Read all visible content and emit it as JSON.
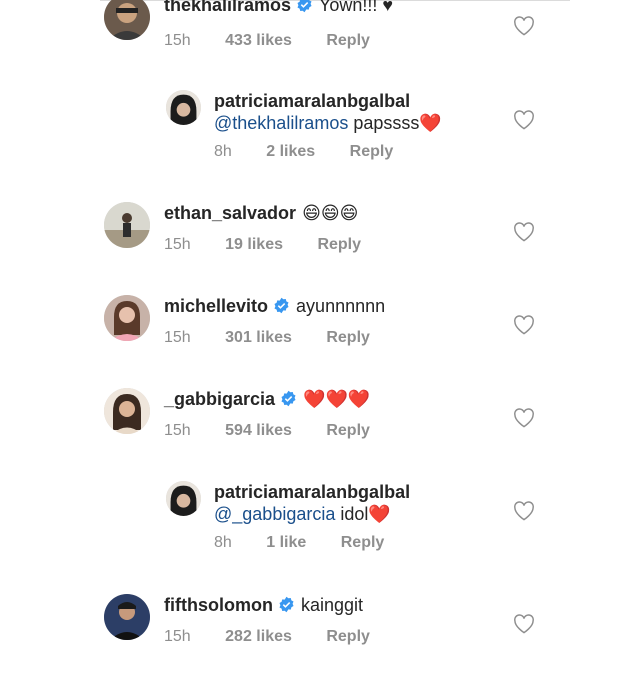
{
  "comments": [
    {
      "username": "thekhalilramos",
      "verified": true,
      "text": "Yown!!! ♥",
      "time": "15h",
      "likes": "433 likes",
      "reply": "Reply"
    },
    {
      "username": "patriciamaralanbgalbal",
      "verified": false,
      "mention": "@thekhalilramos",
      "text": "papssss❤️",
      "time": "8h",
      "likes": "2 likes",
      "reply": "Reply"
    },
    {
      "username": "ethan_salvador",
      "verified": false,
      "text": "😄😄😄",
      "time": "15h",
      "likes": "19 likes",
      "reply": "Reply"
    },
    {
      "username": "michellevito",
      "verified": true,
      "text": "ayunnnnnn",
      "time": "15h",
      "likes": "301 likes",
      "reply": "Reply"
    },
    {
      "username": "_gabbigarcia",
      "verified": true,
      "text": "❤️❤️❤️",
      "time": "15h",
      "likes": "594 likes",
      "reply": "Reply"
    },
    {
      "username": "patriciamaralanbgalbal",
      "verified": false,
      "mention": "@_gabbigarcia",
      "text": "idol❤️",
      "time": "8h",
      "likes": "1 like",
      "reply": "Reply"
    },
    {
      "username": "fifthsolomon",
      "verified": true,
      "text": "kainggit",
      "time": "15h",
      "likes": "282 likes",
      "reply": "Reply"
    }
  ],
  "colors": {
    "verified_badge": "#3897f0",
    "emoji_heart": "#ed1c24",
    "meta_gray": "#8e8e8e",
    "mention_blue": "#1a4f8b"
  },
  "icons": {
    "like": "heart-outline-icon",
    "verified": "verified-badge-icon"
  }
}
